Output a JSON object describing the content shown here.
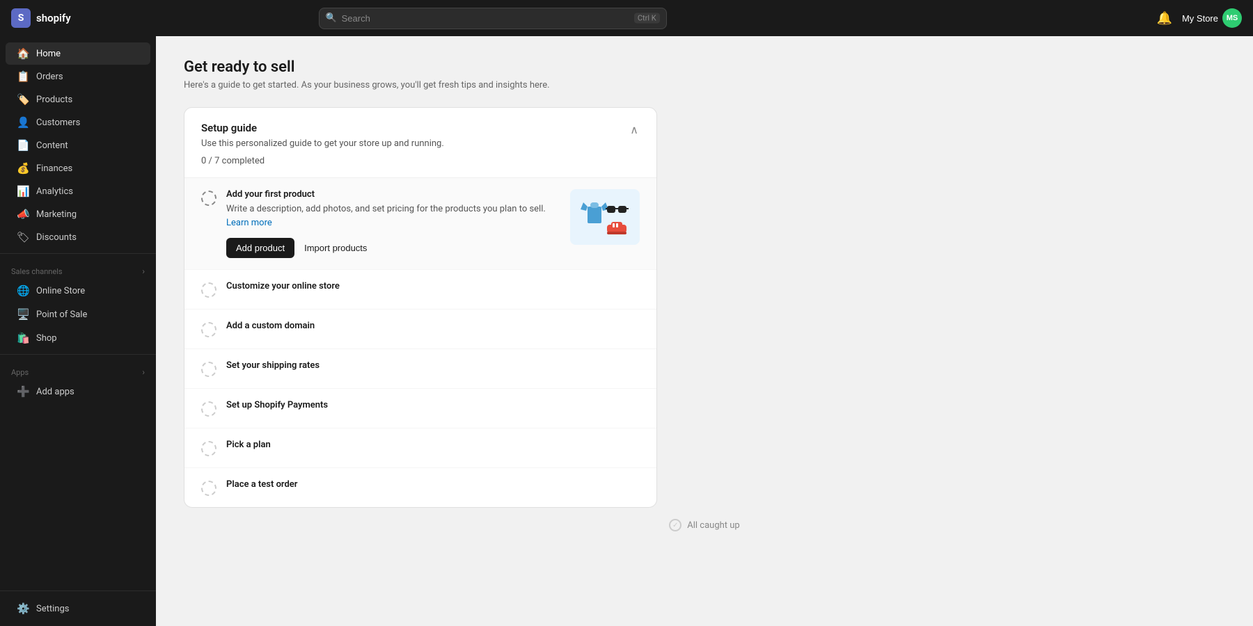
{
  "topnav": {
    "logo_text": "shopify",
    "search_placeholder": "Search",
    "search_shortcut": "Ctrl K",
    "store_name": "My Store",
    "store_initials": "MS"
  },
  "sidebar": {
    "main_items": [
      {
        "id": "home",
        "label": "Home",
        "icon": "🏠",
        "active": true
      },
      {
        "id": "orders",
        "label": "Orders",
        "icon": "📋",
        "active": false
      },
      {
        "id": "products",
        "label": "Products",
        "icon": "🏷️",
        "active": false
      },
      {
        "id": "customers",
        "label": "Customers",
        "icon": "👤",
        "active": false
      },
      {
        "id": "content",
        "label": "Content",
        "icon": "📄",
        "active": false
      },
      {
        "id": "finances",
        "label": "Finances",
        "icon": "💰",
        "active": false
      },
      {
        "id": "analytics",
        "label": "Analytics",
        "icon": "📊",
        "active": false
      },
      {
        "id": "marketing",
        "label": "Marketing",
        "icon": "📣",
        "active": false
      },
      {
        "id": "discounts",
        "label": "Discounts",
        "icon": "🏷",
        "active": false
      }
    ],
    "sales_channels_label": "Sales channels",
    "sales_channels": [
      {
        "id": "online-store",
        "label": "Online Store",
        "icon": "🌐"
      },
      {
        "id": "point-of-sale",
        "label": "Point of Sale",
        "icon": "🖥️"
      },
      {
        "id": "shop",
        "label": "Shop",
        "icon": "🛍️"
      }
    ],
    "apps_label": "Apps",
    "apps_items": [
      {
        "id": "add-apps",
        "label": "Add apps",
        "icon": "➕"
      }
    ],
    "bottom_items": [
      {
        "id": "settings",
        "label": "Settings",
        "icon": "⚙️"
      }
    ]
  },
  "main": {
    "page_title": "Get ready to sell",
    "page_subtitle": "Here's a guide to get started. As your business grows, you'll get fresh tips and insights here.",
    "setup_guide": {
      "title": "Setup guide",
      "description": "Use this personalized guide to get your store up and running.",
      "progress": "0 / 7 completed",
      "items": [
        {
          "id": "add-first-product",
          "title": "Add your first product",
          "description": "Write a description, add photos, and set pricing for the products you plan to sell.",
          "link_text": "Learn more",
          "expanded": true,
          "primary_action": "Add product",
          "secondary_action": "Import products"
        },
        {
          "id": "customize-store",
          "title": "Customize your online store",
          "expanded": false
        },
        {
          "id": "custom-domain",
          "title": "Add a custom domain",
          "expanded": false
        },
        {
          "id": "shipping-rates",
          "title": "Set your shipping rates",
          "expanded": false
        },
        {
          "id": "shopify-payments",
          "title": "Set up Shopify Payments",
          "expanded": false
        },
        {
          "id": "pick-plan",
          "title": "Pick a plan",
          "expanded": false
        },
        {
          "id": "test-order",
          "title": "Place a test order",
          "expanded": false
        }
      ]
    },
    "all_caught_up": "All caught up"
  }
}
